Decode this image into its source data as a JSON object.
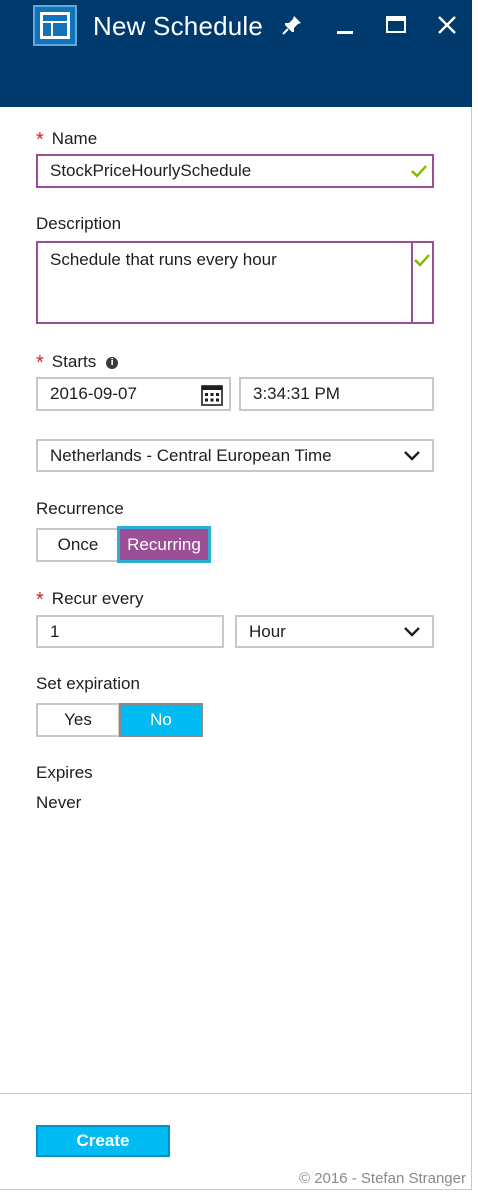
{
  "header": {
    "title": "New Schedule",
    "icons": [
      "schedule-blade-icon",
      "pin-icon",
      "minimize-icon",
      "maximize-icon",
      "close-icon"
    ]
  },
  "form": {
    "name": {
      "label": "Name",
      "required_mark": "*",
      "value": "StockPriceHourlySchedule",
      "valid": true
    },
    "description": {
      "label": "Description",
      "value": "Schedule that runs every hour",
      "valid": true
    },
    "starts": {
      "label": "Starts",
      "required_mark": "*",
      "info_icon": "i",
      "date": "2016-09-07",
      "time": "3:34:31 PM",
      "timezone": "Netherlands - Central European Time"
    },
    "recurrence": {
      "label": "Recurrence",
      "options": [
        "Once",
        "Recurring"
      ],
      "selected": "Recurring"
    },
    "recur_every": {
      "label": "Recur every",
      "required_mark": "*",
      "value": "1",
      "unit": "Hour"
    },
    "set_expiration": {
      "label": "Set expiration",
      "options": [
        "Yes",
        "No"
      ],
      "selected": "No"
    },
    "expires": {
      "label": "Expires",
      "value": "Never"
    }
  },
  "footer": {
    "create_label": "Create"
  },
  "watermark": "© 2016 - Stefan Stranger",
  "colors": {
    "header_bg": "#003a6c",
    "accent_purple": "#9b4f96",
    "accent_cyan": "#00bcf2",
    "valid_green": "#7fba00",
    "required_red": "#d02030"
  }
}
